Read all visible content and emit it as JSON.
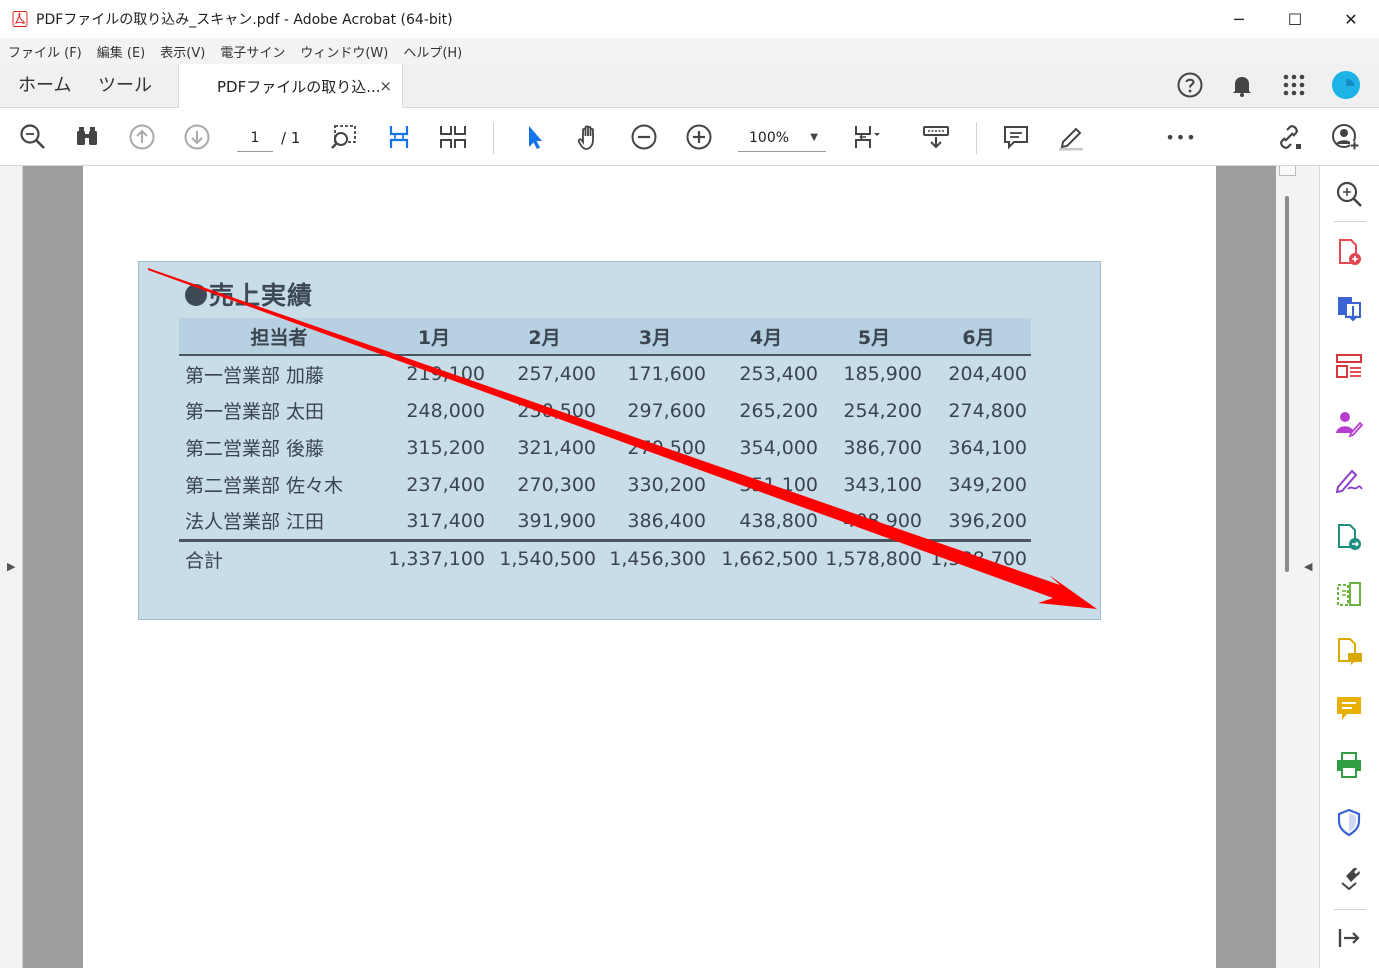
{
  "window": {
    "title": "PDFファイルの取り込み_スキャン.pdf - Adobe Acrobat (64-bit)",
    "minimize": "─",
    "maximize": "☐",
    "close": "✕"
  },
  "menu": [
    "ファイル (F)",
    "編集 (E)",
    "表示(V)",
    "電子サイン",
    "ウィンドウ(W)",
    "ヘルプ(H)"
  ],
  "tabs": {
    "home": "ホーム",
    "tools": "ツール",
    "document": "PDFファイルの取り込...",
    "close": "×"
  },
  "toolbar": {
    "page_current": "1",
    "page_total": "/ 1",
    "zoom": "100%",
    "more": "•••"
  },
  "document": {
    "heading": "売上実績",
    "columns": [
      "担当者",
      "1月",
      "2月",
      "3月",
      "4月",
      "5月",
      "6月"
    ],
    "rows": [
      [
        "第一営業部 加藤",
        "219,100",
        "257,400",
        "171,600",
        "253,400",
        "185,900",
        "204,400"
      ],
      [
        "第一営業部 太田",
        "248,000",
        "230,500",
        "297,600",
        "265,200",
        "254,200",
        "274,800"
      ],
      [
        "第二営業部 後藤",
        "315,200",
        "321,400",
        "270,500",
        "354,000",
        "386,700",
        "364,100"
      ],
      [
        "第二営業部 佐々木",
        "237,400",
        "270,300",
        "330,200",
        "351,100",
        "343,100",
        "349,200"
      ],
      [
        "法人営業部 江田",
        "317,400",
        "391,900",
        "386,400",
        "438,800",
        "408,900",
        "396,200"
      ]
    ],
    "total": [
      "合計",
      "1,337,100",
      "1,540,500",
      "1,456,300",
      "1,662,500",
      "1,578,800",
      "1,588,700"
    ]
  },
  "colors": {
    "scan_bg": "#c9dde8",
    "header_bg": "#b7d1e3",
    "annotation_arrow": "#ff0000",
    "accent_blue": "#1473e6"
  },
  "sidebar_icons": [
    "zoom-tool-icon",
    "create-pdf-icon",
    "export-pdf-icon",
    "organize-pages-icon",
    "request-signature-icon",
    "fill-sign-icon",
    "send-review-icon",
    "compare-icon",
    "comment-doc-icon",
    "comment-icon",
    "print-production-icon",
    "protect-icon",
    "tools-more-icon",
    "exit-panel-icon"
  ]
}
